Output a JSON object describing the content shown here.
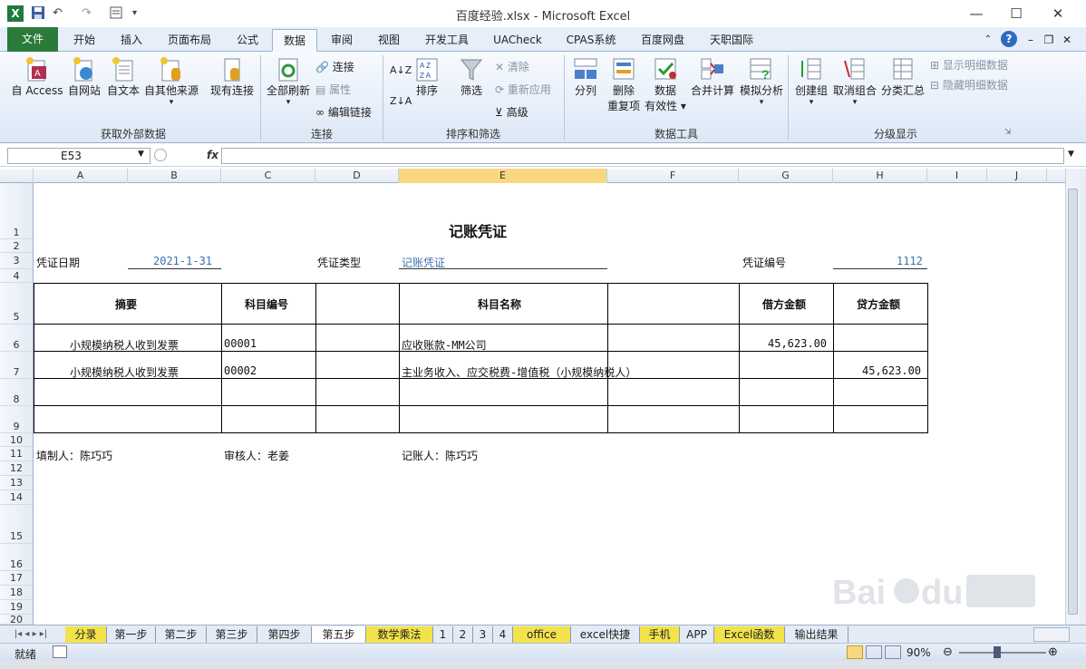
{
  "window": {
    "title": "百度经验.xlsx - Microsoft Excel"
  },
  "quick_access": {
    "undo": "↶",
    "redo": "↷"
  },
  "tabs": [
    "文件",
    "开始",
    "插入",
    "页面布局",
    "公式",
    "数据",
    "审阅",
    "视图",
    "开发工具",
    "UACheck",
    "CPAS系统",
    "百度网盘",
    "天职国际"
  ],
  "ribbon": {
    "groups": {
      "external": "获取外部数据",
      "connections": "连接",
      "sort_filter": "排序和筛选",
      "data_tools": "数据工具",
      "outline": "分级显示"
    },
    "buttons": {
      "access": "自 Access",
      "web": "自网站",
      "text": "自文本",
      "other": "自其他来源",
      "existing": "现有连接",
      "refresh_all": "全部刷新",
      "connections": "连接",
      "properties": "属性",
      "edit_links": "编辑链接",
      "sort": "排序",
      "filter": "筛选",
      "clear": "清除",
      "reapply": "重新应用",
      "advanced": "高级",
      "text_to_cols": "分列",
      "remove_dup_1": "删除",
      "remove_dup_2": "重复项",
      "validation_1": "数据",
      "validation_2": "有效性",
      "consolidate": "合并计算",
      "whatif": "模拟分析",
      "group": "创建组",
      "ungroup": "取消组合",
      "subtotal": "分类汇总",
      "show_detail": "显示明细数据",
      "hide_detail": "隐藏明细数据"
    }
  },
  "formula_bar": {
    "name_box": "E53",
    "fx": "fx",
    "formula": ""
  },
  "columns": [
    "A",
    "B",
    "C",
    "D",
    "E",
    "F",
    "G",
    "H",
    "I",
    "J"
  ],
  "rows": [
    "1",
    "2",
    "3",
    "4",
    "5",
    "6",
    "7",
    "8",
    "9",
    "10",
    "11",
    "12",
    "13",
    "14",
    "15",
    "16",
    "17",
    "18",
    "19",
    "20"
  ],
  "sheet": {
    "title": "记账凭证",
    "date_label": "凭证日期",
    "date_value": "2021-1-31",
    "type_label": "凭证类型",
    "type_value": "记账凭证",
    "no_label": "凭证编号",
    "no_value": "1112",
    "headers": {
      "summary": "摘要",
      "code": "科目编号",
      "name": "科目名称",
      "debit": "借方金额",
      "credit": "贷方金额"
    },
    "lines": [
      {
        "summary": "小规模纳税人收到发票",
        "code": "00001",
        "name": "应收账款-MM公司",
        "debit": "45,623.00",
        "credit": ""
      },
      {
        "summary": "小规模纳税人收到发票",
        "code": "00002",
        "name": "主业务收入、应交税费-增值税（小规模纳税人）",
        "debit": "",
        "credit": "45,623.00"
      }
    ],
    "preparer": "填制人：陈巧巧",
    "reviewer": "审核人：老姜",
    "bookkeeper": "记账人：陈巧巧"
  },
  "sheet_tabs": [
    "分录",
    "第一步",
    "第二步",
    "第三步",
    "第四步",
    "第五步",
    "数学乘法",
    "1",
    "2",
    "3",
    "4",
    "office",
    "excel快捷",
    "手机",
    "APP",
    "Excel函数",
    "输出结果"
  ],
  "active_sheet": "第五步",
  "status": {
    "ready": "就绪",
    "zoom": "90%"
  },
  "colors": {
    "file_tab": "#2a7a3a",
    "selected_header": "#f9d77e",
    "value_blue": "#3a6fb0",
    "tab_yellow": "#f2e34a"
  },
  "icons": [
    "excel-logo-icon",
    "save-icon",
    "undo-icon",
    "redo-icon",
    "minimize-icon",
    "maximize-icon",
    "close-icon",
    "help-icon",
    "watermark-logo"
  ]
}
